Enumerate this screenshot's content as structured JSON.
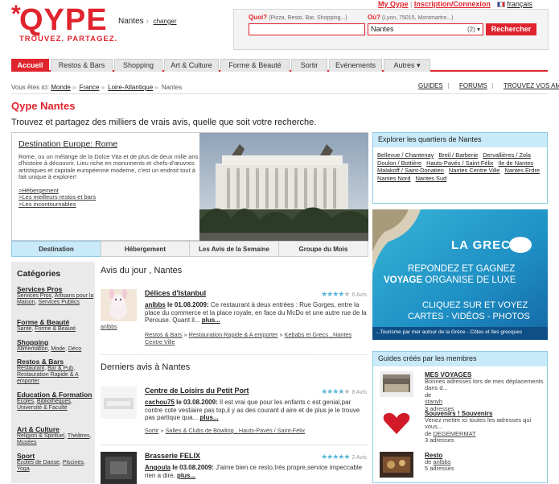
{
  "logo": {
    "name": "QYPE",
    "star": "*",
    "tagline": "TROUVEZ. PARTAGEZ."
  },
  "city": {
    "name": "Nantes",
    "change": "changer"
  },
  "toplinks": {
    "my": "My Qype",
    "signup": "Inscription/Connexion",
    "lang": "français"
  },
  "search": {
    "what_label": "Quoi?",
    "what_hint": "(Pizza, Resto, Bar, Shopping...)",
    "where_label": "Où?",
    "where_hint": "(Lyon, 75015, Montmartre...)",
    "where_value": "Nantes",
    "where_count": "(2)",
    "button": "Rechercher"
  },
  "nav": [
    {
      "label": "Accueil"
    },
    {
      "label": "Restos & Bars"
    },
    {
      "label": "Shopping"
    },
    {
      "label": "Art & Culture"
    },
    {
      "label": "Forme & Beauté"
    },
    {
      "label": "Sortir"
    },
    {
      "label": "Evénements"
    },
    {
      "label": "Autres ▾"
    }
  ],
  "breadcrumb": {
    "prefix": "Vous êtes ici:",
    "items": [
      "Monde",
      "France",
      "Loire-Atlantique",
      "Nantes"
    ]
  },
  "util": {
    "guides": "GUIDES",
    "forums": "FORUMS",
    "find": "TROUVEZ VOS AMIS"
  },
  "page": {
    "title": "Qype Nantes",
    "subtitle": "Trouvez et partagez des milliers de vrais avis, quelle que soit votre recherche."
  },
  "destination": {
    "title": "Destination Europe: Rome",
    "desc": "Rome, ou un mélange de la Dolce Vita et de plus de deux mille ans d'histoire à découvrir. Lieu riche en monuments et chefs-d'œuvres artistiques et capitale européenne moderne, c'est un endroit tout à fait unique à explorer!",
    "links": [
      ">Hébergement",
      ">Les meilleurs restos et bars",
      ">Les incontournables"
    ],
    "tabs": [
      "Destination",
      "Hébergement",
      "Les Avis de la Semaine",
      "Groupe du Mois"
    ]
  },
  "quartiers": {
    "title": "Explorer les quartiers de Nantes",
    "items": [
      "Bellevue / Chantenay",
      "Breil / Barberie",
      "Dervallières / Zola",
      "Doulon / Bottière",
      "Hauts-Pavés / Saint-Félix",
      "Ile de Nantes",
      "Malakoff / Saint-Donatien",
      "Nantes Centre Ville",
      "Nantes Erdre",
      "Nantes Nord",
      "Nantes Sud"
    ]
  },
  "ad": {
    "brand": "LA GRECE",
    "line1": "REPONDEZ ET GAGNEZ",
    "line2a": "VOYAGE",
    "line2b": "ORGANISE DE LUXE",
    "line3": "CLIQUEZ SUR ET VOYEZ",
    "line4": "CARTES - VIDÉOS - PHOTOS",
    "footer": "...Tourisme par mer autour de la Grèce - Côtes et îles grecques"
  },
  "guides": {
    "title": "Guides créés par les membres",
    "items": [
      {
        "name": "MES VOYAGES",
        "desc": "Bonnes adresses lors de mes déplacements dans d...",
        "by": "de",
        "author": "stanyh",
        "count": "3 adresses"
      },
      {
        "name": "Souvenirs ! Souvenirs",
        "desc": "Venez mettre ici toutes les adresses qui vous...",
        "by": "de",
        "author": "DEGEMERMAT",
        "count": "3 adresses"
      },
      {
        "name": "Resto",
        "desc": "",
        "by": "de",
        "author": "anlbbs",
        "count": "5 adresses"
      }
    ]
  },
  "categories": {
    "title": "Catégories",
    "items": [
      {
        "head": "Services Pros",
        "subs": [
          "Services Pros",
          "Artisans pour la Maison",
          "Services Publics"
        ]
      },
      {
        "head": "Forme & Beauté",
        "subs": [
          "Santé",
          "Forme & Beauté"
        ]
      },
      {
        "head": "Shopping",
        "subs": [
          "Alimentation",
          "Mode",
          "Déco"
        ]
      },
      {
        "head": "Restos & Bars",
        "subs": [
          "Restaurant",
          "Bar & Pub",
          "Restauration Rapide & A emporter"
        ]
      },
      {
        "head": "Education & Formation",
        "subs": [
          "Ecoles",
          "Bibliothèques",
          "Université & Faculté"
        ]
      },
      {
        "head": "Art & Culture",
        "subs": [
          "Religion & Spirituel",
          "Théâtres",
          "Musées"
        ]
      },
      {
        "head": "Sport",
        "subs": [
          "Ecoles de Danse",
          "Piscines",
          "Yoga"
        ]
      }
    ]
  },
  "avis_jour": {
    "title": "Avis du jour , Nantes",
    "name": "Délices d'Istanbul",
    "count": "6 Avis",
    "user": "anlbbs",
    "date": "le 01.08.2009:",
    "text": "Ce restaurant à deux entrées : Rue Gorges, entre la place du commerce et la place royale, en face du McDo et une autre rue de la Perouse. Quant il...",
    "more": "plus...",
    "cats": [
      "Restos & Bars",
      "Restauration Rapide & A emporter",
      "Kebabs et Grecs , Nantes Centre Ville"
    ],
    "thumb_user": "anlbbs"
  },
  "derniers": {
    "title": "Derniers avis à Nantes",
    "items": [
      {
        "name": "Centre de Loisirs du Petit Port",
        "count": "8 Avis",
        "user": "cachou75",
        "date": "le 03.08.2009:",
        "text": "Il est vrai que pour les enfants c est genial,par contre cote vestiaire pas top,il y as des courant d aire et de plus je le trouve pas partique qua...",
        "more": "plus...",
        "cats": [
          "Sortir",
          "Salles & Clubs de Bowling , Hauts-Pavés / Saint-Félix"
        ]
      },
      {
        "name": "Brasserie FELIX",
        "count": "2 Avis",
        "user": "Angoula",
        "date": "le 03.08.2009:",
        "text": "J'aime bien ce resto,très propre,service impeccable rien a dire.",
        "more": "plus...",
        "cats": []
      }
    ]
  },
  "colors": {
    "brand": "#e0242e",
    "accent": "#c9eaf8"
  }
}
